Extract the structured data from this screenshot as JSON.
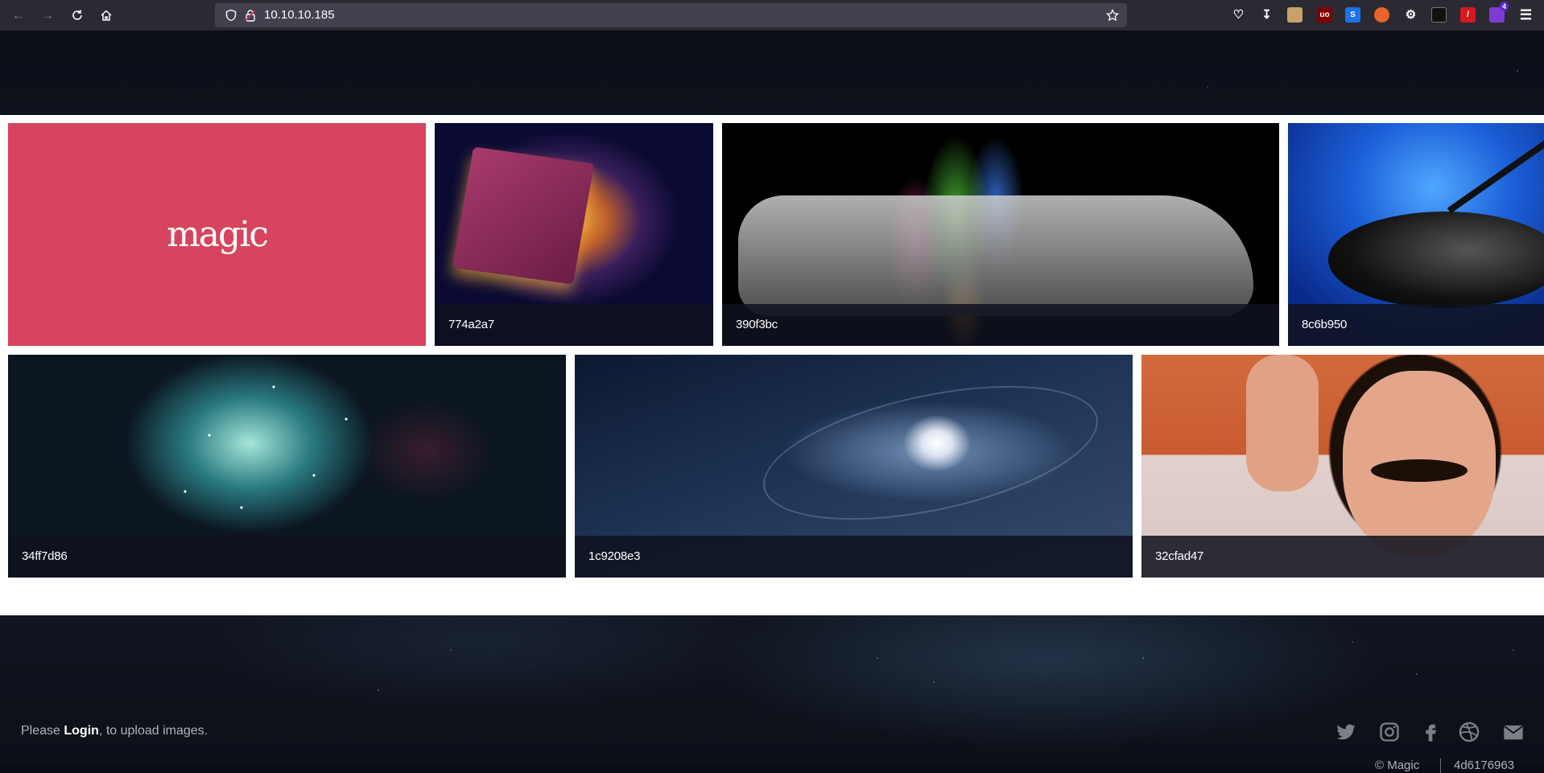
{
  "browser": {
    "url": "10.10.10.185",
    "extension_badge": "4"
  },
  "gallery": {
    "logo_text": "magic",
    "images": [
      {
        "caption": "774a2a7",
        "theme": "glowing-spellbook"
      },
      {
        "caption": "390f3bc",
        "theme": "hand-with-colored-smoke"
      },
      {
        "caption": "8c6b950",
        "theme": "magic-hat-and-wand"
      },
      {
        "caption": "34ff7d86",
        "theme": "sparkling-light-swirls"
      },
      {
        "caption": "1c9208e3",
        "theme": "galaxy-in-hand"
      },
      {
        "caption": "32cfad47",
        "theme": "magician-gesture"
      }
    ]
  },
  "footer": {
    "login_prefix": "Please ",
    "login_link": "Login",
    "login_suffix": ", to upload images.",
    "copyright": "© Magic",
    "hash": "4d6176963",
    "social_icons": [
      "twitter-icon",
      "instagram-icon",
      "facebook-icon",
      "dribbble-icon",
      "email-icon"
    ]
  },
  "colors": {
    "logo_tile": "#d6455d",
    "chrome": "#2b2a33",
    "urlbar": "#42414d"
  }
}
